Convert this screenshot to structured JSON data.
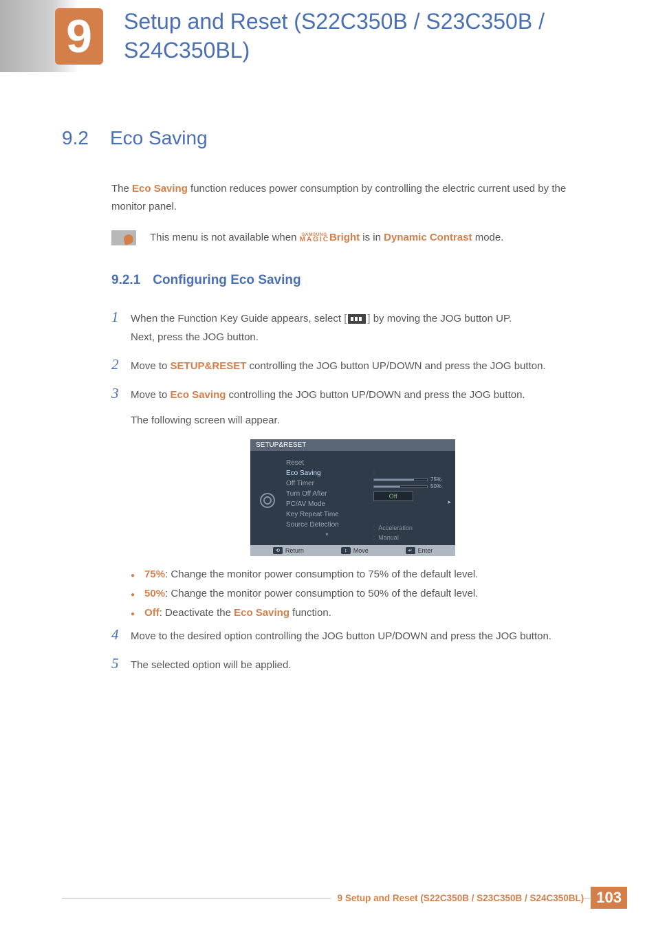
{
  "header": {
    "chapter_number": "9",
    "chapter_title": "Setup and Reset (S22C350B / S23C350B / S24C350BL)"
  },
  "section": {
    "number": "9.2",
    "title": "Eco Saving"
  },
  "intro": {
    "prefix": "The ",
    "keyword": "Eco Saving",
    "suffix": " function reduces power consumption by controlling the electric current used by the monitor panel."
  },
  "note": {
    "prefix": "This menu is not available when ",
    "magic_top": "SAMSUNG",
    "magic_bottom": "MAGIC",
    "bright_kw": "Bright",
    "mid": " is in ",
    "dc_kw": "Dynamic Contrast",
    "suffix": " mode."
  },
  "subsection": {
    "number": "9.2.1",
    "title": "Configuring Eco Saving"
  },
  "steps": {
    "s1_num": "1",
    "s1a": "When the Function Key Guide appears, select ",
    "s1b": " by moving the JOG button UP.",
    "s1c": "Next, press the JOG button.",
    "s2_num": "2",
    "s2a": "Move to ",
    "s2_kw": "SETUP&RESET",
    "s2b": " controlling the JOG button UP/DOWN and press the JOG button.",
    "s3_num": "3",
    "s3a": "Move to ",
    "s3_kw": "Eco Saving",
    "s3b": " controlling the JOG button UP/DOWN and press the JOG button.",
    "s3c": "The following screen will appear."
  },
  "osd": {
    "title": "SETUP&RESET",
    "items": [
      "Reset",
      "Eco Saving",
      "Off Timer",
      "Turn Off After",
      "PC/AV Mode",
      "Key Repeat Time",
      "Source Detection"
    ],
    "bar_labels": [
      "75%",
      "50%"
    ],
    "off_label": "Off",
    "key_repeat_val": "Acceleration",
    "source_det_val": "Manual",
    "footer": {
      "return": "Return",
      "move": "Move",
      "enter": "Enter"
    }
  },
  "bullets": {
    "b1_kw": "75%",
    "b1_txt": ": Change the monitor power consumption to 75% of the default level.",
    "b2_kw": "50%",
    "b2_txt": ": Change the monitor power consumption to 50% of the default level.",
    "b3_kw": "Off",
    "b3_mid": ": Deactivate the ",
    "b3_kw2": "Eco Saving",
    "b3_end": " function."
  },
  "steps2": {
    "s4_num": "4",
    "s4": "Move to the desired option controlling the JOG button UP/DOWN and press the JOG button.",
    "s5_num": "5",
    "s5": "The selected option will be applied."
  },
  "footer": {
    "label": "9 Setup and Reset (S22C350B / S23C350B / S24C350BL)",
    "page": "103"
  }
}
